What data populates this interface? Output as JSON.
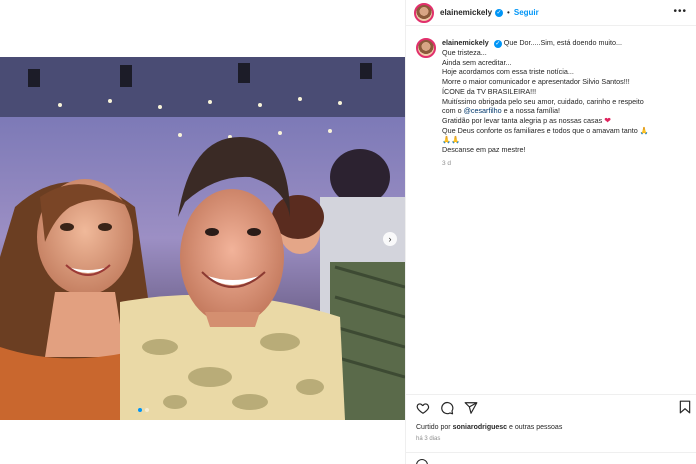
{
  "post": {
    "username": "elainemickely",
    "follow_label": "Seguir",
    "separator": "•",
    "more_label": "•••",
    "next_label": "›"
  },
  "caption": {
    "username": "elainemickely",
    "lines": [
      "Que Dor.....Sim, está doendo muito...",
      "Que tristeza...",
      "Ainda sem acreditar...",
      "Hoje acordamos com essa triste notícia...",
      "Morre o maior comunicador e apresentador Silvio Santos!!!",
      "ÍCONE da TV BRASILEIRA!!!",
      "Muitíssimo obrigada pelo seu amor, cuidado, carinho e respeito",
      "com o",
      "@cesarfilho",
      "e a nossa família!",
      "Gratidão por levar tanta alegria p as nossas casas",
      "Que Deus conforte os familiares e todos que o amavam tanto",
      "🙏🙏",
      "Descanse em paz mestre!"
    ],
    "time_ago": "3 d"
  },
  "footer": {
    "liked_prefix": "Curtido por",
    "liked_user": "soniarodriguesc",
    "liked_suffix": "e outras pessoas",
    "posted": "há 3 dias"
  },
  "icons": {
    "like": "heart-icon",
    "comment": "comment-icon",
    "share": "share-icon",
    "save": "bookmark-icon",
    "verified": "verified-badge-icon",
    "pray": "🙏",
    "heart": "❤"
  },
  "colors": {
    "accent": "#0095f6",
    "text": "#262626",
    "muted": "#8e8e8e",
    "mention": "#00376b",
    "heart": "#e0245e"
  }
}
